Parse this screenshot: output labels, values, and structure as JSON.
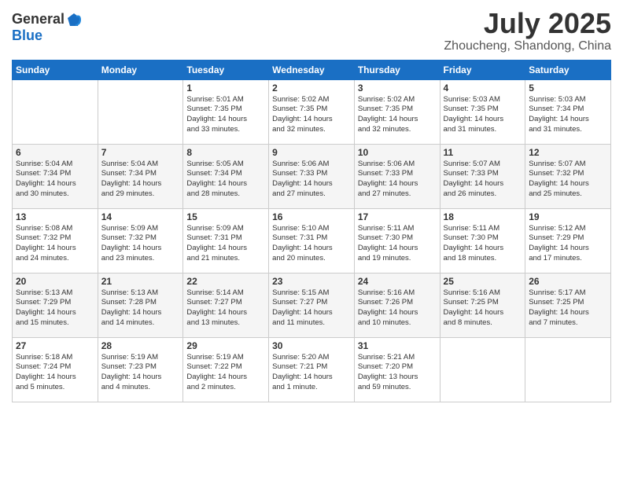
{
  "header": {
    "logo_line1": "General",
    "logo_line2": "Blue",
    "month": "July 2025",
    "location": "Zhoucheng, Shandong, China"
  },
  "weekdays": [
    "Sunday",
    "Monday",
    "Tuesday",
    "Wednesday",
    "Thursday",
    "Friday",
    "Saturday"
  ],
  "weeks": [
    [
      {
        "day": "",
        "info": ""
      },
      {
        "day": "",
        "info": ""
      },
      {
        "day": "1",
        "info": "Sunrise: 5:01 AM\nSunset: 7:35 PM\nDaylight: 14 hours\nand 33 minutes."
      },
      {
        "day": "2",
        "info": "Sunrise: 5:02 AM\nSunset: 7:35 PM\nDaylight: 14 hours\nand 32 minutes."
      },
      {
        "day": "3",
        "info": "Sunrise: 5:02 AM\nSunset: 7:35 PM\nDaylight: 14 hours\nand 32 minutes."
      },
      {
        "day": "4",
        "info": "Sunrise: 5:03 AM\nSunset: 7:35 PM\nDaylight: 14 hours\nand 31 minutes."
      },
      {
        "day": "5",
        "info": "Sunrise: 5:03 AM\nSunset: 7:34 PM\nDaylight: 14 hours\nand 31 minutes."
      }
    ],
    [
      {
        "day": "6",
        "info": "Sunrise: 5:04 AM\nSunset: 7:34 PM\nDaylight: 14 hours\nand 30 minutes."
      },
      {
        "day": "7",
        "info": "Sunrise: 5:04 AM\nSunset: 7:34 PM\nDaylight: 14 hours\nand 29 minutes."
      },
      {
        "day": "8",
        "info": "Sunrise: 5:05 AM\nSunset: 7:34 PM\nDaylight: 14 hours\nand 28 minutes."
      },
      {
        "day": "9",
        "info": "Sunrise: 5:06 AM\nSunset: 7:33 PM\nDaylight: 14 hours\nand 27 minutes."
      },
      {
        "day": "10",
        "info": "Sunrise: 5:06 AM\nSunset: 7:33 PM\nDaylight: 14 hours\nand 27 minutes."
      },
      {
        "day": "11",
        "info": "Sunrise: 5:07 AM\nSunset: 7:33 PM\nDaylight: 14 hours\nand 26 minutes."
      },
      {
        "day": "12",
        "info": "Sunrise: 5:07 AM\nSunset: 7:32 PM\nDaylight: 14 hours\nand 25 minutes."
      }
    ],
    [
      {
        "day": "13",
        "info": "Sunrise: 5:08 AM\nSunset: 7:32 PM\nDaylight: 14 hours\nand 24 minutes."
      },
      {
        "day": "14",
        "info": "Sunrise: 5:09 AM\nSunset: 7:32 PM\nDaylight: 14 hours\nand 23 minutes."
      },
      {
        "day": "15",
        "info": "Sunrise: 5:09 AM\nSunset: 7:31 PM\nDaylight: 14 hours\nand 21 minutes."
      },
      {
        "day": "16",
        "info": "Sunrise: 5:10 AM\nSunset: 7:31 PM\nDaylight: 14 hours\nand 20 minutes."
      },
      {
        "day": "17",
        "info": "Sunrise: 5:11 AM\nSunset: 7:30 PM\nDaylight: 14 hours\nand 19 minutes."
      },
      {
        "day": "18",
        "info": "Sunrise: 5:11 AM\nSunset: 7:30 PM\nDaylight: 14 hours\nand 18 minutes."
      },
      {
        "day": "19",
        "info": "Sunrise: 5:12 AM\nSunset: 7:29 PM\nDaylight: 14 hours\nand 17 minutes."
      }
    ],
    [
      {
        "day": "20",
        "info": "Sunrise: 5:13 AM\nSunset: 7:29 PM\nDaylight: 14 hours\nand 15 minutes."
      },
      {
        "day": "21",
        "info": "Sunrise: 5:13 AM\nSunset: 7:28 PM\nDaylight: 14 hours\nand 14 minutes."
      },
      {
        "day": "22",
        "info": "Sunrise: 5:14 AM\nSunset: 7:27 PM\nDaylight: 14 hours\nand 13 minutes."
      },
      {
        "day": "23",
        "info": "Sunrise: 5:15 AM\nSunset: 7:27 PM\nDaylight: 14 hours\nand 11 minutes."
      },
      {
        "day": "24",
        "info": "Sunrise: 5:16 AM\nSunset: 7:26 PM\nDaylight: 14 hours\nand 10 minutes."
      },
      {
        "day": "25",
        "info": "Sunrise: 5:16 AM\nSunset: 7:25 PM\nDaylight: 14 hours\nand 8 minutes."
      },
      {
        "day": "26",
        "info": "Sunrise: 5:17 AM\nSunset: 7:25 PM\nDaylight: 14 hours\nand 7 minutes."
      }
    ],
    [
      {
        "day": "27",
        "info": "Sunrise: 5:18 AM\nSunset: 7:24 PM\nDaylight: 14 hours\nand 5 minutes."
      },
      {
        "day": "28",
        "info": "Sunrise: 5:19 AM\nSunset: 7:23 PM\nDaylight: 14 hours\nand 4 minutes."
      },
      {
        "day": "29",
        "info": "Sunrise: 5:19 AM\nSunset: 7:22 PM\nDaylight: 14 hours\nand 2 minutes."
      },
      {
        "day": "30",
        "info": "Sunrise: 5:20 AM\nSunset: 7:21 PM\nDaylight: 14 hours\nand 1 minute."
      },
      {
        "day": "31",
        "info": "Sunrise: 5:21 AM\nSunset: 7:20 PM\nDaylight: 13 hours\nand 59 minutes."
      },
      {
        "day": "",
        "info": ""
      },
      {
        "day": "",
        "info": ""
      }
    ]
  ]
}
